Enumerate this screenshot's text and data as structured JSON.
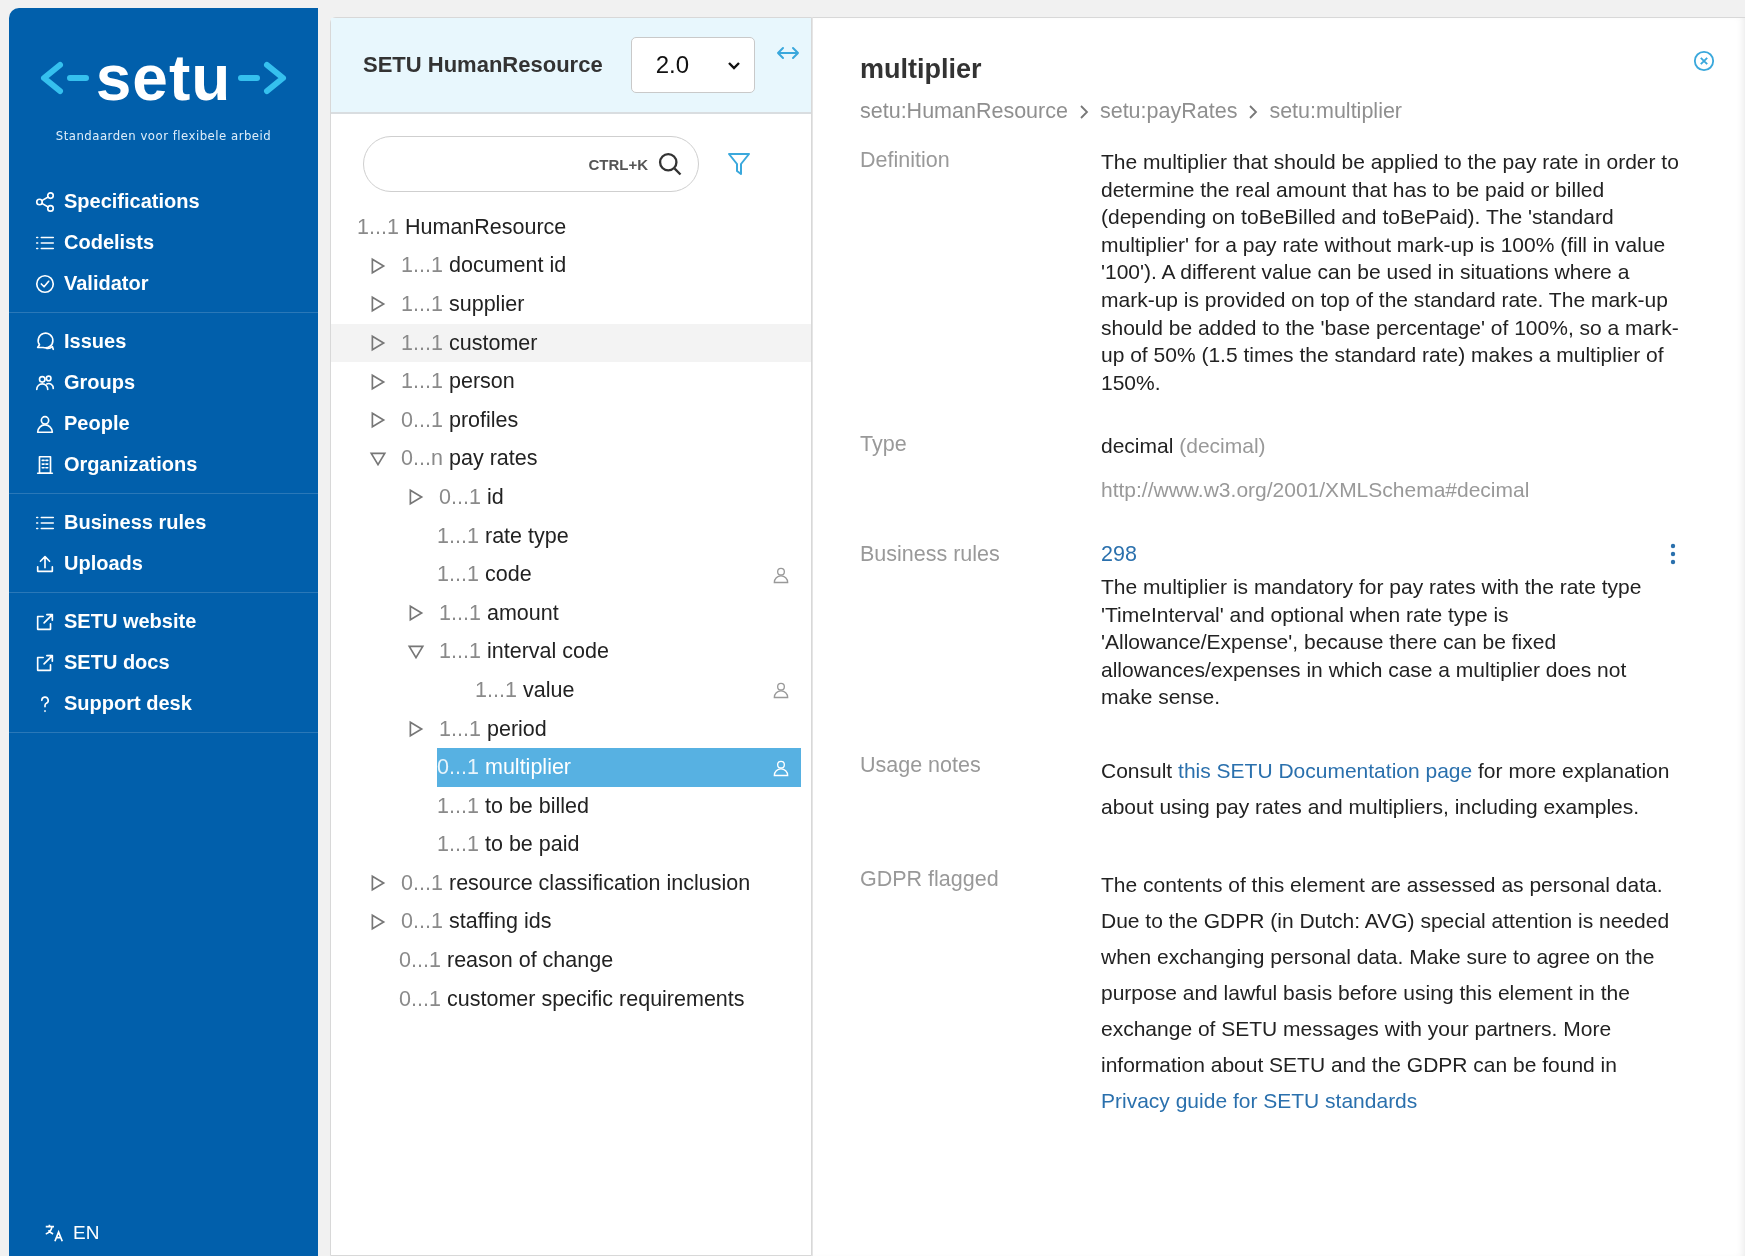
{
  "sidebar": {
    "logo": {
      "name": "setu",
      "tagline": "Standaarden voor flexibele arbeid"
    },
    "groups": [
      [
        {
          "label": "Specifications",
          "kind": "share"
        },
        {
          "label": "Codelists",
          "kind": "list"
        },
        {
          "label": "Validator",
          "kind": "badge"
        }
      ],
      [
        {
          "label": "Issues",
          "kind": "chat"
        },
        {
          "label": "Groups",
          "kind": "group"
        },
        {
          "label": "People",
          "kind": "person"
        },
        {
          "label": "Organizations",
          "kind": "building"
        }
      ],
      [
        {
          "label": "Business rules",
          "kind": "list"
        },
        {
          "label": "Uploads",
          "kind": "upload"
        }
      ],
      [
        {
          "label": "SETU website",
          "kind": "external"
        },
        {
          "label": "SETU docs",
          "kind": "external"
        },
        {
          "label": "Support desk",
          "kind": "help"
        }
      ]
    ],
    "language": "EN"
  },
  "tree_panel": {
    "title": "SETU HumanResource",
    "version": "2.0",
    "search": {
      "shortcut": "CTRL+K"
    },
    "tree": [
      {
        "count": "1...1",
        "name": "HumanResource",
        "kind": "root",
        "selected": false,
        "hovered": false,
        "gdpr": false,
        "children": [
          {
            "count": "1...1",
            "name": "document id",
            "kind": "branch",
            "expanded": false,
            "selected": false,
            "hovered": false,
            "gdpr": false
          },
          {
            "count": "1...1",
            "name": "supplier",
            "kind": "branch",
            "expanded": false,
            "selected": false,
            "hovered": false,
            "gdpr": false
          },
          {
            "count": "1...1",
            "name": "customer",
            "kind": "branch",
            "expanded": false,
            "selected": false,
            "hovered": true,
            "gdpr": false
          },
          {
            "count": "1...1",
            "name": "person",
            "kind": "branch",
            "expanded": false,
            "selected": false,
            "hovered": false,
            "gdpr": false
          },
          {
            "count": "0...1",
            "name": "profiles",
            "kind": "branch",
            "expanded": false,
            "selected": false,
            "hovered": false,
            "gdpr": false
          },
          {
            "count": "0...n",
            "name": "pay rates",
            "kind": "branch",
            "expanded": true,
            "selected": false,
            "hovered": false,
            "gdpr": false,
            "children": [
              {
                "count": "0...1",
                "name": "id",
                "kind": "branch",
                "expanded": false,
                "selected": false,
                "hovered": false,
                "gdpr": false
              },
              {
                "count": "1...1",
                "name": "rate type",
                "kind": "leaf",
                "selected": false,
                "hovered": false,
                "gdpr": false
              },
              {
                "count": "1...1",
                "name": "code",
                "kind": "leaf",
                "selected": false,
                "hovered": false,
                "gdpr": true
              },
              {
                "count": "1...1",
                "name": "amount",
                "kind": "branch",
                "expanded": false,
                "selected": false,
                "hovered": false,
                "gdpr": false
              },
              {
                "count": "1...1",
                "name": "interval code",
                "kind": "branch",
                "expanded": true,
                "selected": false,
                "hovered": false,
                "gdpr": false,
                "children": [
                  {
                    "count": "1...1",
                    "name": "value",
                    "kind": "leaf",
                    "selected": false,
                    "hovered": false,
                    "gdpr": true
                  }
                ]
              },
              {
                "count": "1...1",
                "name": "period",
                "kind": "branch",
                "expanded": false,
                "selected": false,
                "hovered": false,
                "gdpr": false
              },
              {
                "count": "0...1",
                "name": "multiplier",
                "kind": "leaf",
                "selected": true,
                "hovered": false,
                "gdpr": true
              },
              {
                "count": "1...1",
                "name": "to be billed",
                "kind": "leaf",
                "selected": false,
                "hovered": false,
                "gdpr": false
              },
              {
                "count": "1...1",
                "name": "to be paid",
                "kind": "leaf",
                "selected": false,
                "hovered": false,
                "gdpr": false
              }
            ]
          },
          {
            "count": "0...1",
            "name": "resource classification inclusion",
            "kind": "branch",
            "expanded": false,
            "selected": false,
            "hovered": false,
            "gdpr": false
          },
          {
            "count": "0...1",
            "name": "staffing ids",
            "kind": "branch",
            "expanded": false,
            "selected": false,
            "hovered": false,
            "gdpr": false
          },
          {
            "count": "0...1",
            "name": "reason of change",
            "kind": "leaf",
            "selected": false,
            "hovered": false,
            "gdpr": false
          },
          {
            "count": "0...1",
            "name": "customer specific requirements",
            "kind": "leaf",
            "selected": false,
            "hovered": false,
            "gdpr": false
          }
        ]
      }
    ]
  },
  "detail": {
    "title": "multiplier",
    "breadcrumb": [
      "setu:HumanResource",
      "setu:payRates",
      "setu:multiplier"
    ],
    "sections": [
      {
        "kind": "text",
        "label": "Definition",
        "text": "The multiplier that should be applied to the pay rate in order to determine the real amount that has to be paid or billed (depending on toBeBilled and toBePaid). The 'standard multiplier' for a pay rate without mark-up is 100% (fill in value '100'). A different value can be used in situations where a mark-up is provided on top of the standard rate. The mark-up should be added to the 'base percentage' of 100%, so a mark-up of 50% (1.5 times the standard rate) makes a multiplier of 150%."
      },
      {
        "kind": "type",
        "label": "Type",
        "type": "decimal",
        "base": "(decimal)",
        "url": "http://www.w3.org/2001/XMLSchema#decimal"
      },
      {
        "kind": "rule",
        "label": "Business rules",
        "number": "298",
        "text": "The multiplier is mandatory for pay rates with the rate type 'TimeInterval' and optional when rate type is 'Allowance/Expense', because there can be fixed allowances/expenses in which case a multiplier does not make sense."
      },
      {
        "kind": "rich",
        "label": "Usage notes",
        "parts": [
          {
            "kind": "text",
            "text": "Consult "
          },
          {
            "kind": "link",
            "text": "this SETU Documentation page"
          },
          {
            "kind": "text",
            "text": " for more explanation about using pay rates and multipliers, including examples."
          }
        ]
      },
      {
        "kind": "rich",
        "label": "GDPR flagged",
        "parts": [
          {
            "kind": "text",
            "text": "The contents of this element are assessed as personal data. Due to the GDPR (in Dutch: AVG) special attention is needed when exchanging personal data. Make sure to agree on the purpose and lawful basis before using this element in the exchange of SETU messages with your partners. More information about SETU and the GDPR can be found in "
          },
          {
            "kind": "link",
            "text": "Privacy guide for SETU standards"
          }
        ]
      }
    ]
  }
}
